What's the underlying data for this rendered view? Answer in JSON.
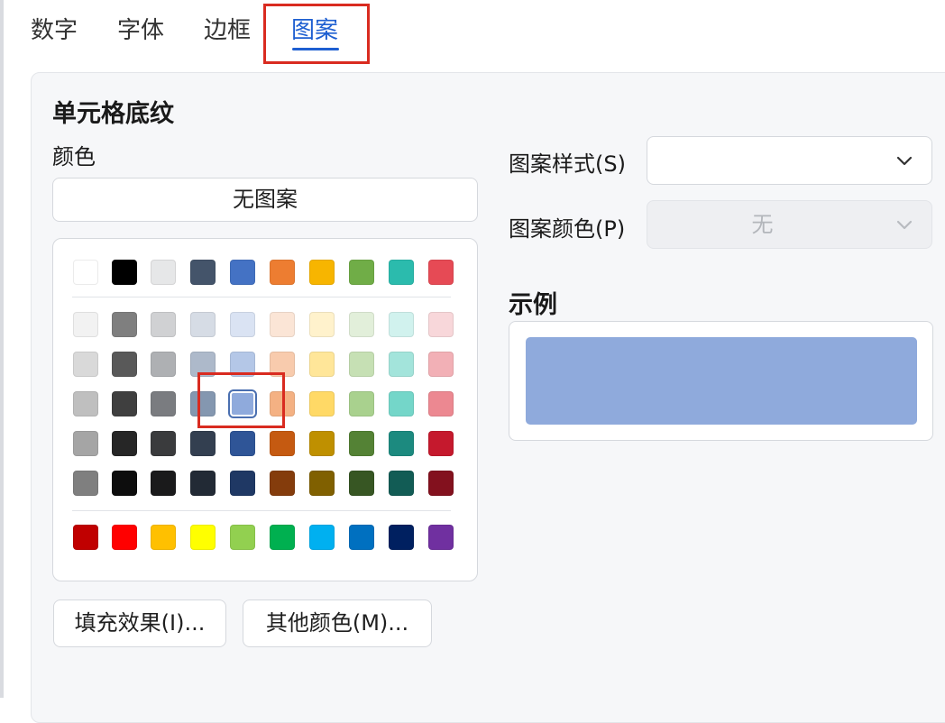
{
  "tabs": [
    "数字",
    "字体",
    "边框",
    "图案"
  ],
  "active_tab": "图案",
  "shading": {
    "section_title": "单元格底纹",
    "color_label": "颜色",
    "no_pattern_label": "无图案"
  },
  "palette": {
    "theme_row": [
      "#ffffff",
      "#000000",
      "#e6e7e8",
      "#44546a",
      "#4472c4",
      "#ed7d31",
      "#f7b500",
      "#70ad47",
      "#2bbbad",
      "#e64a55"
    ],
    "tint_rows": [
      [
        "#f2f2f2",
        "#7f7f7f",
        "#d0d1d3",
        "#d6dce5",
        "#dae3f3",
        "#fbe5d6",
        "#fff2cc",
        "#e2efda",
        "#d1f2ee",
        "#f8d7da"
      ],
      [
        "#d9d9d9",
        "#595959",
        "#aeb0b3",
        "#adb9ca",
        "#b4c7e7",
        "#f8cbad",
        "#ffe699",
        "#c6e0b4",
        "#a3e4db",
        "#f2b0b6"
      ],
      [
        "#bfbfbf",
        "#3f3f3f",
        "#7a7c80",
        "#8497b0",
        "#8faadc",
        "#f4b183",
        "#ffd966",
        "#a9d18e",
        "#74d6c9",
        "#ec8891"
      ],
      [
        "#a5a5a5",
        "#262626",
        "#3a3b3d",
        "#333f50",
        "#2f5597",
        "#c55a11",
        "#bf9000",
        "#548235",
        "#1c8a7f",
        "#c5192d"
      ],
      [
        "#7f7f7f",
        "#0d0d0d",
        "#1a1a1b",
        "#222a35",
        "#1f3864",
        "#843c0c",
        "#806000",
        "#375623",
        "#125c55",
        "#83111e"
      ]
    ],
    "standard_row": [
      "#c00000",
      "#ff0000",
      "#ffc000",
      "#ffff00",
      "#92d050",
      "#00b050",
      "#00b0f0",
      "#0070c0",
      "#002060",
      "#7030a0"
    ],
    "selected": {
      "row": 2,
      "col": 4,
      "color": "#8faadc"
    }
  },
  "buttons": {
    "fill_effects": "填充效果(I)...",
    "more_colors": "其他颜色(M)..."
  },
  "pattern_style": {
    "label": "图案样式(S)",
    "value": ""
  },
  "pattern_color": {
    "label": "图案颜色(P)",
    "value": "无"
  },
  "sample": {
    "label": "示例",
    "color": "#8faadc"
  },
  "annotation_color": "#d92b20"
}
